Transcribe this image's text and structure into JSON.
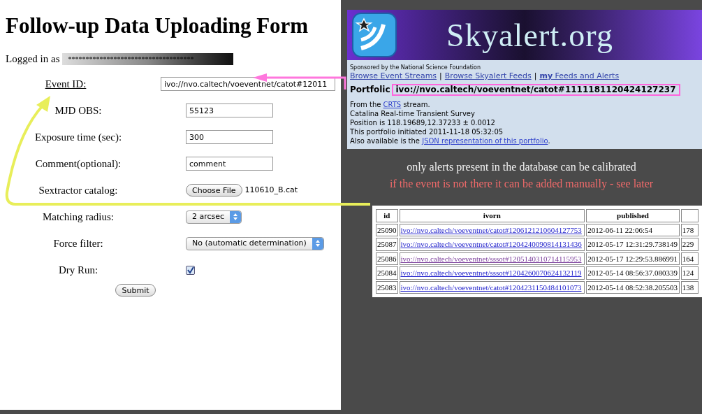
{
  "form": {
    "title": "Follow-up Data Uploading Form",
    "logged_in_label": "Logged in as",
    "username": "************************************",
    "fields": [
      {
        "kind": "text",
        "label": "Event ID:",
        "label_is_link": true,
        "value": "ivo://nvo.caltech/voeventnet/catot#12011"
      },
      {
        "kind": "text",
        "label": "MJD OBS:",
        "label_is_link": false,
        "value": "55123"
      },
      {
        "kind": "text",
        "label": "Exposure time (sec):",
        "label_is_link": false,
        "value": "300"
      },
      {
        "kind": "text",
        "label": "Comment(optional):",
        "label_is_link": false,
        "value": "comment"
      },
      {
        "kind": "file",
        "label": "Sextractor catalog:",
        "label_is_link": false,
        "button": "Choose File",
        "value": "110610_B.cat"
      },
      {
        "kind": "select",
        "label": "Matching radius:",
        "label_is_link": false,
        "value": "2 arcsec"
      },
      {
        "kind": "select",
        "label": "Force filter:",
        "label_is_link": false,
        "value": "No (automatic determination)"
      },
      {
        "kind": "checkbox",
        "label": "Dry Run:",
        "label_is_link": false,
        "checked": true
      }
    ],
    "submit": "Submit"
  },
  "skyalert": {
    "banner_title": "Skyalert.org",
    "sponsor": "Sponsored by the National Science Foundation",
    "nav": [
      {
        "kind": "link",
        "text": "Browse Event Streams"
      },
      {
        "kind": "separator",
        "text": "|"
      },
      {
        "kind": "link",
        "text": "Browse Skyalert Feeds"
      },
      {
        "kind": "separator",
        "text": "|"
      },
      {
        "kind": "link",
        "text": "**my** Feeds and Alerts"
      }
    ],
    "portfolio_label": "Portfolic",
    "portfolio_id": "ivo://nvo.caltech/voeventnet/catot#1111181120424127237",
    "info": [
      {
        "before": "From the ",
        "link": "CRTS",
        "after": " stream."
      },
      {
        "before": "Catalina Real-time Transient Survey"
      },
      {
        "before": "Position is 118.19689,12.37233 ± 0.0012"
      },
      {
        "before": "This portfolio initiated 2011-11-18 05:32:05"
      },
      {
        "before": "Also available is the ",
        "link": "JSON representation of this portfolio",
        "after": "."
      }
    ]
  },
  "captions": [
    {
      "kind": "note",
      "text": "only alerts present in the database can be calibrated"
    },
    {
      "kind": "warning",
      "text": "if the event is not there it can be added manually - see later"
    }
  ],
  "table": {
    "columns": [
      "id",
      "ivorn",
      "published",
      ""
    ],
    "rows": [
      {
        "id": "25090",
        "ivorn": "ivo://nvo.caltech/voeventnet/catot#1206121210604127753",
        "visited": false,
        "published": "2012-06-11 22:06:54",
        "column_4": "178"
      },
      {
        "id": "25087",
        "ivorn": "ivo://nvo.caltech/voeventnet/catot#1204240090814131436",
        "visited": false,
        "published": "2012-05-17 12:31:29.738149",
        "column_4": "229"
      },
      {
        "id": "25086",
        "ivorn": "ivo://nvo.caltech/voeventnet/sssot#1205140310714115953",
        "visited": true,
        "published": "2012-05-17 12:29:53.886991",
        "column_4": "164"
      },
      {
        "id": "25084",
        "ivorn": "ivo://nvo.caltech/voeventnet/sssot#1204260070624132119",
        "visited": false,
        "published": "2012-05-14 08:56:37.080339",
        "column_4": "124"
      },
      {
        "id": "25083",
        "ivorn": "ivo://nvo.caltech/voeventnet/catot#1204231150484101073",
        "visited": false,
        "published": "2012-05-14 08:52:38.205503",
        "column_4": "138"
      }
    ]
  }
}
